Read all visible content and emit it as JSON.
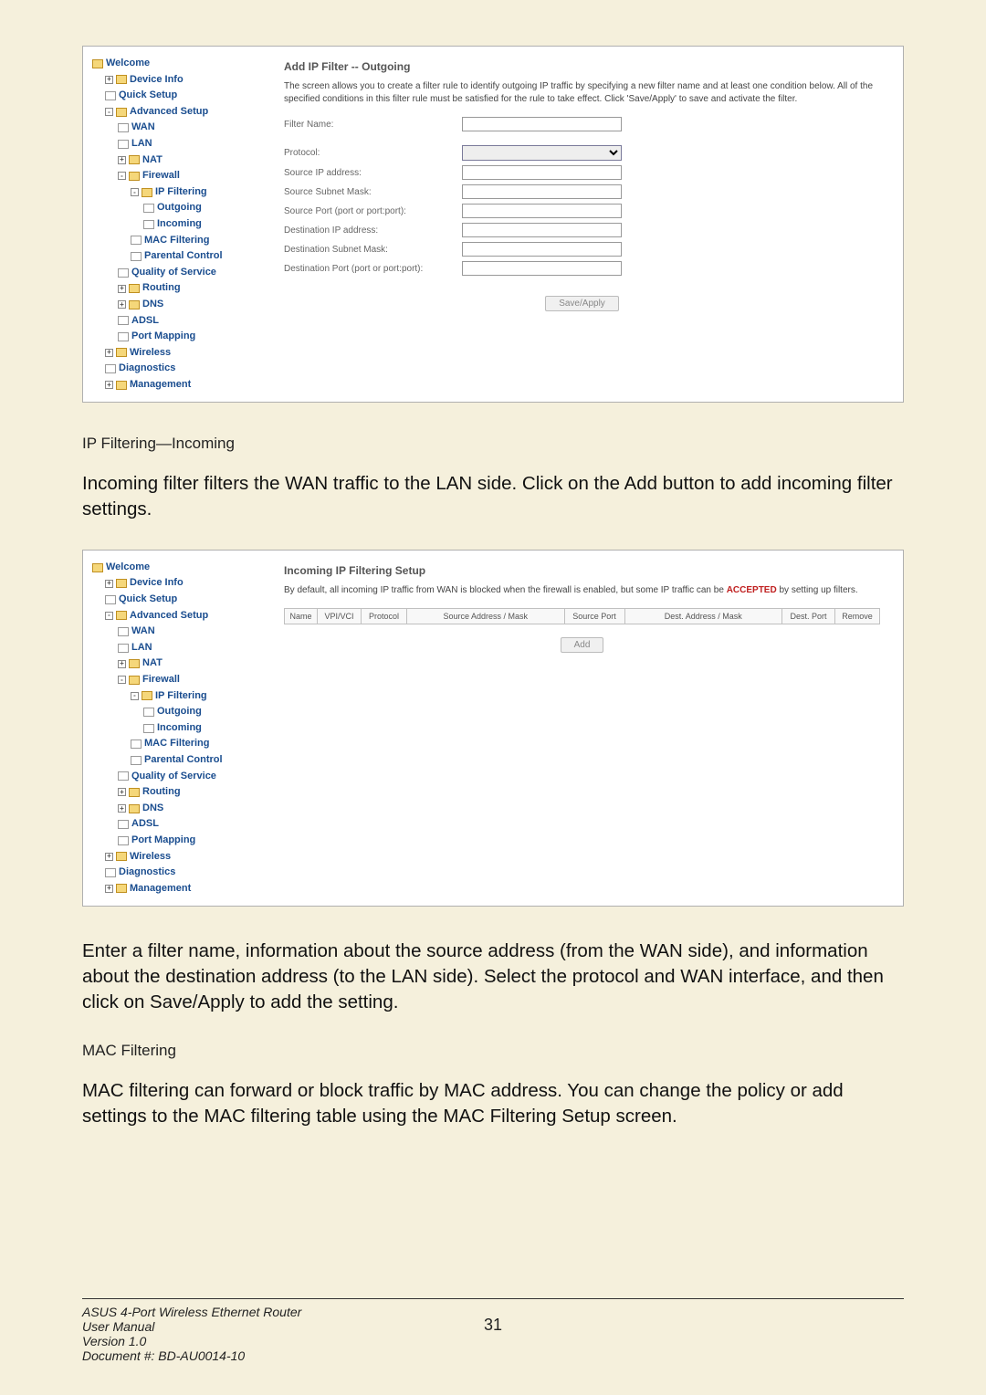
{
  "screenshot1": {
    "panel_title": "Add IP Filter -- Outgoing",
    "panel_desc": "The screen allows you to create a filter rule to identify outgoing IP traffic by specifying a new filter name and at least one condition below. All of the specified conditions in this filter rule must be satisfied for the rule to take effect. Click 'Save/Apply' to save and activate the filter.",
    "fields": {
      "filter_name": "Filter Name:",
      "protocol": "Protocol:",
      "src_ip": "Source IP address:",
      "src_mask": "Source Subnet Mask:",
      "src_port": "Source Port (port or port:port):",
      "dst_ip": "Destination IP address:",
      "dst_mask": "Destination Subnet Mask:",
      "dst_port": "Destination Port (port or port:port):"
    },
    "button": "Save/Apply"
  },
  "heading1": "IP Filtering—Incoming",
  "para1": "Incoming filter filters the WAN traffic to the LAN side.  Click on the Add button to add incoming filter settings.",
  "screenshot2": {
    "panel_title": "Incoming IP Filtering Setup",
    "panel_desc_pre": "By default, all incoming IP traffic from WAN is blocked when the firewall is enabled, but some IP traffic can be ",
    "panel_desc_bold": "ACCEPTED",
    "panel_desc_post": " by setting up filters.",
    "columns": [
      "Name",
      "VPI/VCI",
      "Protocol",
      "Source Address / Mask",
      "Source Port",
      "Dest. Address / Mask",
      "Dest. Port",
      "Remove"
    ],
    "button": "Add"
  },
  "para2": "Enter a filter name, information about the source address (from the WAN side), and information about the destination address (to the LAN side). Select the protocol and WAN interface, and then click on Save/Apply to add the setting.",
  "heading2": "MAC Filtering",
  "para3": "MAC filtering can forward or block traffic by MAC address. You can change the policy or add settings to the MAC filtering table using the MAC Filtering Setup screen.",
  "tree": {
    "welcome": "Welcome",
    "device_info": "Device Info",
    "quick_setup": "Quick Setup",
    "advanced_setup": "Advanced Setup",
    "wan": "WAN",
    "lan": "LAN",
    "nat": "NAT",
    "firewall": "Firewall",
    "ip_filtering": "IP Filtering",
    "outgoing": "Outgoing",
    "incoming": "Incoming",
    "mac_filtering": "MAC Filtering",
    "parental": "Parental Control",
    "qos": "Quality of Service",
    "routing": "Routing",
    "dns": "DNS",
    "adsl": "ADSL",
    "port_mapping": "Port Mapping",
    "wireless": "Wireless",
    "diagnostics": "Diagnostics",
    "management": "Management"
  },
  "footer": {
    "line1": "ASUS 4-Port Wireless Ethernet Router",
    "line2": "User Manual",
    "line3": "Version 1.0",
    "line4": "Document #:  BD-AU0014-10",
    "page": "31"
  }
}
